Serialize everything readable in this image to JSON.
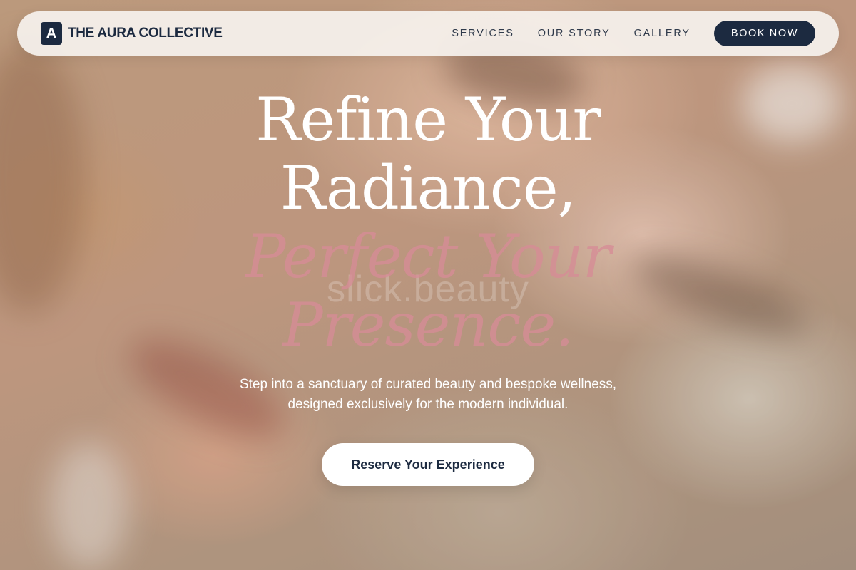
{
  "brand": {
    "mark": "A",
    "name": "THE AURA COLLECTIVE"
  },
  "nav": {
    "links": [
      "SERVICES",
      "OUR STORY",
      "GALLERY"
    ],
    "book_label": "BOOK NOW"
  },
  "hero": {
    "headline_line1": "Refine Your",
    "headline_line2": "Radiance,",
    "accent_line1": "Perfect Your",
    "accent_line2": "Presence.",
    "watermark": "slick.beauty",
    "subtext": "Step into a sanctuary of curated beauty and bespoke wellness, designed exclusively for the modern individual.",
    "cta_label": "Reserve Your Experience"
  },
  "colors": {
    "brand_navy": "#1c2a40",
    "accent_pink": "#d68c96",
    "nav_bg": "#f6f2ee"
  }
}
